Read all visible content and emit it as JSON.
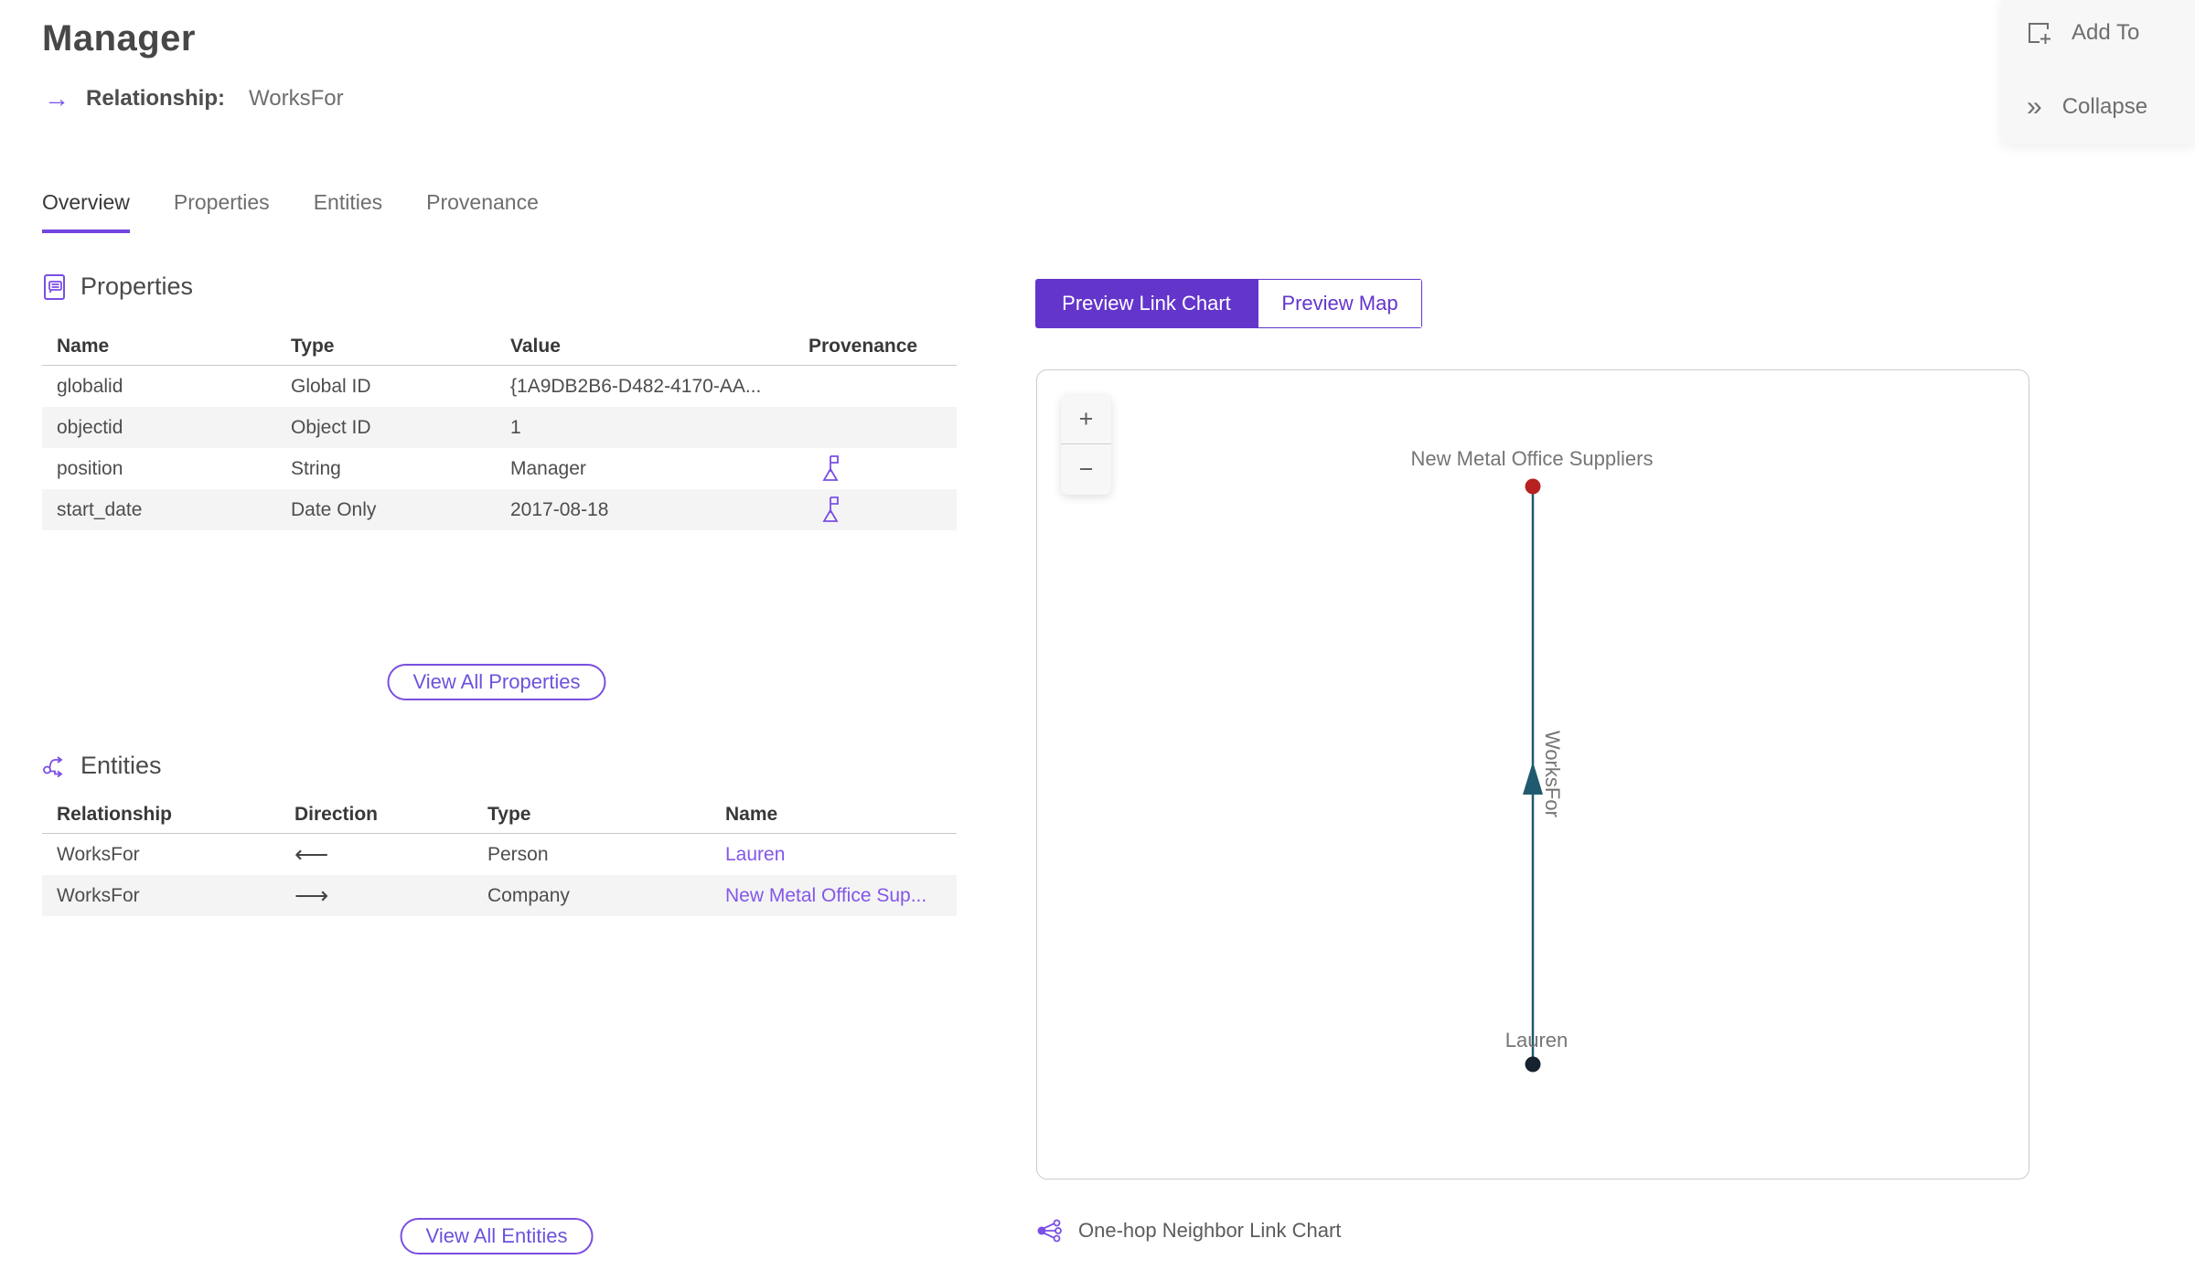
{
  "header": {
    "title": "Manager",
    "arrow_glyph": "→",
    "relationship_label": "Relationship:",
    "relationship_value": "WorksFor"
  },
  "floating_actions": {
    "add_to_label": "Add To",
    "collapse_label": "Collapse",
    "collapse_glyph": "»"
  },
  "tabs": [
    {
      "label": "Overview",
      "active": true
    },
    {
      "label": "Properties",
      "active": false
    },
    {
      "label": "Entities",
      "active": false
    },
    {
      "label": "Provenance",
      "active": false
    }
  ],
  "properties_section": {
    "title": "Properties",
    "columns": {
      "name": "Name",
      "type": "Type",
      "value": "Value",
      "provenance": "Provenance"
    },
    "rows": [
      {
        "name": "globalid",
        "type": "Global ID",
        "value": "{1A9DB2B6-D482-4170-AA...",
        "provenance_flag": false
      },
      {
        "name": "objectid",
        "type": "Object ID",
        "value": "1",
        "provenance_flag": false
      },
      {
        "name": "position",
        "type": "String",
        "value": "Manager",
        "provenance_flag": true
      },
      {
        "name": "start_date",
        "type": "Date Only",
        "value": "2017-08-18",
        "provenance_flag": true
      }
    ],
    "view_all_label": "View All Properties"
  },
  "entities_section": {
    "title": "Entities",
    "columns": {
      "relationship": "Relationship",
      "direction": "Direction",
      "type": "Type",
      "name": "Name"
    },
    "rows": [
      {
        "relationship": "WorksFor",
        "direction": "incoming",
        "direction_glyph": "⟵",
        "type": "Person",
        "name": "Lauren"
      },
      {
        "relationship": "WorksFor",
        "direction": "outgoing",
        "direction_glyph": "⟶",
        "type": "Company",
        "name": "New Metal Office Sup..."
      }
    ],
    "view_all_label": "View All Entities"
  },
  "preview": {
    "link_chart_tab": "Preview Link Chart",
    "map_tab": "Preview Map",
    "zoom_in_glyph": "+",
    "zoom_out_glyph": "−",
    "caption": "One-hop Neighbor Link Chart"
  },
  "chart_data": {
    "type": "link-chart",
    "nodes": [
      {
        "id": "company",
        "label": "New Metal Office Suppliers",
        "color": "#b7211f"
      },
      {
        "id": "person",
        "label": "Lauren",
        "color": "#16232e"
      }
    ],
    "edges": [
      {
        "label": "WorksFor",
        "from": "Lauren",
        "to": "New Metal Office Suppliers",
        "color": "#1f5a6e",
        "arrow_direction": "up"
      }
    ]
  },
  "colors": {
    "accent_purple": "#6335cb",
    "icon_purple": "#7a4fe4",
    "link_purple": "#8257e8",
    "edge_teal": "#1f5a6e",
    "node_red": "#b7211f",
    "node_dark": "#16232e",
    "stripe_gray": "#f4f4f4"
  }
}
